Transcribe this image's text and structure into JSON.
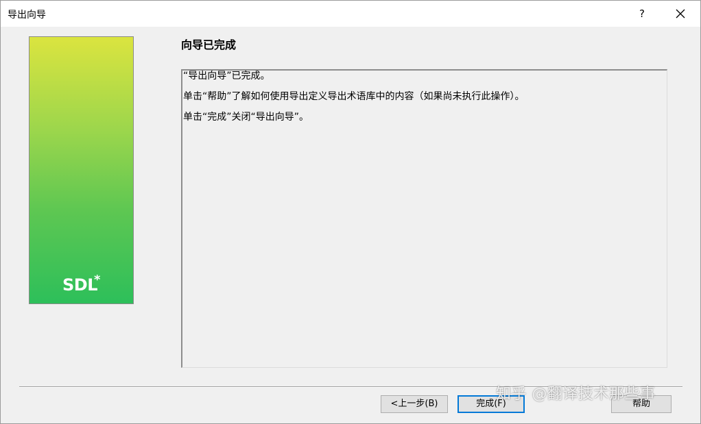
{
  "window": {
    "title": "导出向导",
    "help_glyph": "?"
  },
  "banner": {
    "logo_text": "SDL",
    "logo_mark": "*"
  },
  "page": {
    "title": "向导已完成",
    "lines": [
      "“导出向导”已完成。",
      "单击“帮助”了解如何使用导出定义导出术语库中的内容（如果尚未执行此操作）。",
      "单击“完成”关闭“导出向导”。"
    ]
  },
  "buttons": {
    "back": "<上一步(B)",
    "finish": "完成(F)",
    "help": "帮助"
  },
  "watermark": {
    "text": "知乎 @翻译技术那些事"
  },
  "colors": {
    "banner_top": "#dbe43f",
    "banner_bottom": "#2dbf5a",
    "default_button_border": "#0078d7"
  }
}
